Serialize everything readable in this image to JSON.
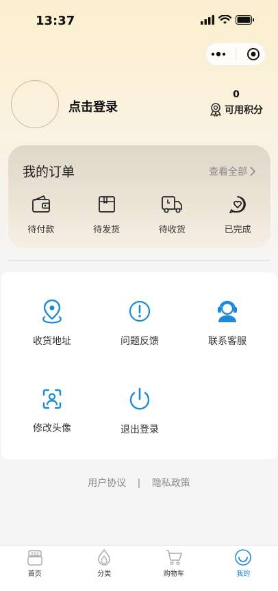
{
  "status_bar": {
    "time": "13:37"
  },
  "profile": {
    "login_text": "点击登录",
    "points_value": "0",
    "points_label": "可用积分"
  },
  "orders": {
    "title": "我的订单",
    "view_all": "查看全部",
    "items": [
      {
        "label": "待付款",
        "icon": "wallet-icon"
      },
      {
        "label": "待发货",
        "icon": "package-icon"
      },
      {
        "label": "待收货",
        "icon": "delivery-truck-icon"
      },
      {
        "label": "已完成",
        "icon": "heart-chat-icon"
      }
    ]
  },
  "services": [
    {
      "label": "收货地址",
      "icon": "location-pin-icon"
    },
    {
      "label": "问题反馈",
      "icon": "exclamation-icon"
    },
    {
      "label": "联系客服",
      "icon": "customer-service-icon"
    },
    {
      "label": "修改头像",
      "icon": "face-scan-icon"
    },
    {
      "label": "退出登录",
      "icon": "power-icon"
    }
  ],
  "footer": {
    "user_agreement": "用户协议",
    "separator": "|",
    "privacy_policy": "隐私政策"
  },
  "tabbar": [
    {
      "label": "首页",
      "icon": "home-icon",
      "active": false
    },
    {
      "label": "分类",
      "icon": "category-icon",
      "active": false
    },
    {
      "label": "购物车",
      "icon": "cart-icon",
      "active": false
    },
    {
      "label": "我的",
      "icon": "profile-icon",
      "active": true
    }
  ],
  "colors": {
    "accent": "#1c8ad6",
    "header_bg": "#fbefcf",
    "card_bg": "#ffffff"
  }
}
